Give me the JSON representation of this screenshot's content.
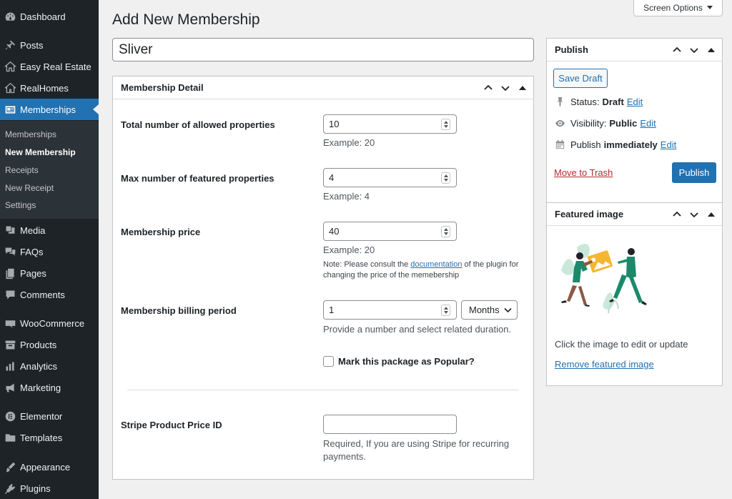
{
  "sidebar": {
    "items": [
      {
        "label": "Dashboard",
        "icon": "dashboard-icon"
      },
      {
        "label": "Posts",
        "icon": "pin-icon"
      },
      {
        "label": "Easy Real Estate",
        "icon": "house-icon"
      },
      {
        "label": "RealHomes",
        "icon": "house-outline-icon"
      },
      {
        "label": "Memberships",
        "icon": "id-card-icon"
      },
      {
        "label": "Media",
        "icon": "media-icon"
      },
      {
        "label": "FAQs",
        "icon": "faq-icon"
      },
      {
        "label": "Pages",
        "icon": "pages-icon"
      },
      {
        "label": "Comments",
        "icon": "comment-icon"
      },
      {
        "label": "WooCommerce",
        "icon": "woo-icon"
      },
      {
        "label": "Products",
        "icon": "archive-icon"
      },
      {
        "label": "Analytics",
        "icon": "chart-bar-icon"
      },
      {
        "label": "Marketing",
        "icon": "megaphone-icon"
      },
      {
        "label": "Elementor",
        "icon": "elementor-icon"
      },
      {
        "label": "Templates",
        "icon": "folder-icon"
      },
      {
        "label": "Appearance",
        "icon": "brush-icon"
      },
      {
        "label": "Plugins",
        "icon": "plug-icon"
      }
    ],
    "submenu": [
      "Memberships",
      "New Membership",
      "Receipts",
      "New Receipt",
      "Settings"
    ]
  },
  "header": {
    "title": "Add New Membership",
    "screen_options": "Screen Options"
  },
  "post_title": {
    "value": "Sliver"
  },
  "membership_detail": {
    "title": "Membership Detail",
    "allowed_properties": {
      "label": "Total number of allowed properties",
      "value": "10",
      "help": "Example: 20"
    },
    "featured_properties": {
      "label": "Max number of featured properties",
      "value": "4",
      "help": "Example: 4"
    },
    "price": {
      "label": "Membership price",
      "value": "40",
      "help": "Example: 20",
      "note_before": "Note: Please consult the ",
      "note_link": "documentation",
      "note_after": " of the plugin for changing the price of the memebership"
    },
    "billing": {
      "label": "Membership billing period",
      "value": "1",
      "period": "Months",
      "help": "Provide a number and select related duration."
    },
    "popular": {
      "label": "Mark this package as Popular?",
      "checked": false
    },
    "stripe": {
      "label": "Stripe Product Price ID",
      "value": "",
      "help": "Required, If you are using Stripe for recurring payments."
    }
  },
  "publish": {
    "title": "Publish",
    "save_draft": "Save Draft",
    "status_label": "Status:",
    "status_value": "Draft",
    "visibility_label": "Visibility:",
    "visibility_value": "Public",
    "publish_label": "Publish",
    "publish_value": "immediately",
    "edit": "Edit",
    "trash": "Move to Trash",
    "publish_button": "Publish"
  },
  "featured_image": {
    "title": "Featured image",
    "caption": "Click the image to edit or update",
    "remove": "Remove featured image"
  },
  "colors": {
    "sidebar_bg": "#1d2327",
    "accent": "#2271b1",
    "illustration_green": "#1b8a6b",
    "illustration_yellow": "#f5b731"
  }
}
